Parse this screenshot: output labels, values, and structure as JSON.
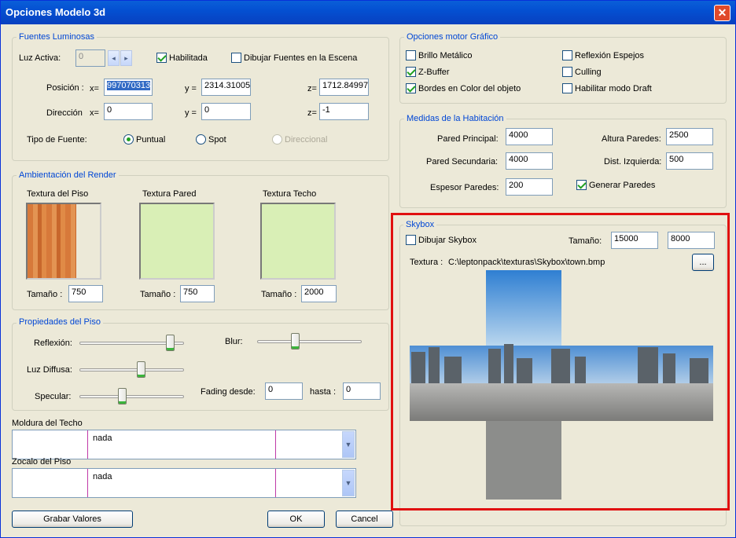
{
  "window": {
    "title": "Opciones Modelo 3d",
    "close_icon": "close-icon"
  },
  "fuentes": {
    "title": "Fuentes Luminosas",
    "luz_activa_label": "Luz Activa:",
    "luz_activa_value": "0",
    "habilitada": "Habilitada",
    "dibujar_fuentes": "Dibujar Fuentes en la Escena",
    "posicion_label": "Posición :",
    "x_label": "x=",
    "y_label": "y =",
    "z_label": "z=",
    "pos_x": "997070313",
    "pos_y": "2314.31005",
    "pos_z": "1712.84997",
    "direccion_label": "Dirección",
    "dir_x": "0",
    "dir_y": "0",
    "dir_z": "-1",
    "tipo_label": "Tipo de Fuente:",
    "puntual": "Puntual",
    "spot": "Spot",
    "direccional": "Direccional"
  },
  "render": {
    "title": "Ambientación del Render",
    "piso_label": "Textura del Piso",
    "pared_label": "Textura Pared",
    "techo_label": "Textura Techo",
    "tam_label": "Tamaño :",
    "tam_piso": "750",
    "tam_pared": "750",
    "tam_techo": "2000"
  },
  "piso": {
    "title": "Propiedades del Piso",
    "reflexion": "Reflexión:",
    "blur": "Blur:",
    "luz_diffusa": "Luz Diffusa:",
    "specular": "Specular:",
    "fading_desde": "Fading desde:",
    "fading_desde_val": "0",
    "hasta": "hasta :",
    "hasta_val": "0",
    "levels": {
      "reflexion": 0.9,
      "blur": 0.35,
      "luz_diffusa": 0.6,
      "specular": 0.4
    }
  },
  "moldura": {
    "label": "Moldura del Techo",
    "value": "nada"
  },
  "zocalo": {
    "label": "Zocalo del Piso",
    "value": "nada"
  },
  "motor": {
    "title": "Opciones motor Gráfico",
    "brillo": "Brillo Metálico",
    "zbuffer": "Z-Buffer",
    "bordes": "Bordes en Color del objeto",
    "reflexion_espejos": "Reflexión Espejos",
    "culling": "Culling",
    "draft": "Habilitar modo Draft"
  },
  "medidas": {
    "title": "Medidas de la Habitación",
    "pared_principal": "Pared Principal:",
    "pared_principal_val": "4000",
    "pared_secundaria": "Pared Secundaria:",
    "pared_secundaria_val": "4000",
    "espesor": "Espesor Paredes:",
    "espesor_val": "200",
    "altura": "Altura Paredes:",
    "altura_val": "2500",
    "dist_izq": "Dist. Izquierda:",
    "dist_izq_val": "500",
    "generar": "Generar Paredes"
  },
  "skybox": {
    "title": "Skybox",
    "dibujar": "Dibujar Skybox",
    "tamano_label": "Tamaño:",
    "tam1": "15000",
    "tam2": "8000",
    "textura_label": "Textura :",
    "textura_path": "C:\\leptonpack\\texturas\\Skybox\\town.bmp",
    "browse": "..."
  },
  "buttons": {
    "grabar": "Grabar Valores",
    "ok": "OK",
    "cancel": "Cancel"
  }
}
